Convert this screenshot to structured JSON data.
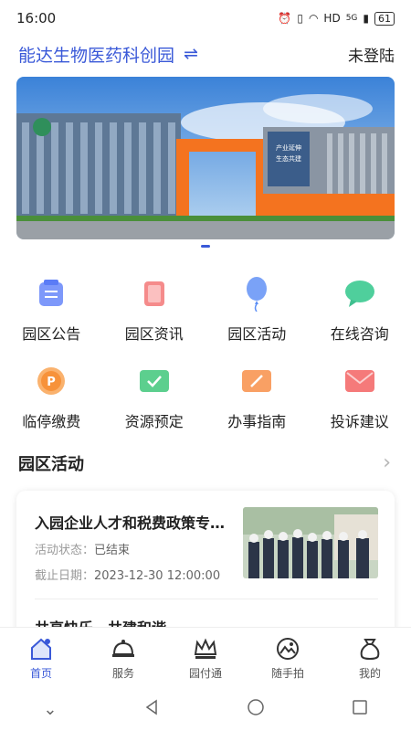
{
  "status": {
    "time": "16:00",
    "network": "HD",
    "signal": "5G",
    "battery": "61"
  },
  "header": {
    "park_name": "能达生物医药科创园",
    "login": "未登陆"
  },
  "banner": {
    "sign_text_1": "产业延伸",
    "sign_text_2": "生态共建"
  },
  "quick_links": [
    {
      "label": "园区公告",
      "icon": "notice-icon",
      "color": "#5b7cf6"
    },
    {
      "label": "园区资讯",
      "icon": "news-icon",
      "color": "#f36b6b"
    },
    {
      "label": "园区活动",
      "icon": "balloon-icon",
      "color": "#5b8ef6"
    },
    {
      "label": "在线咨询",
      "icon": "chat-icon",
      "color": "#3fbf8f"
    },
    {
      "label": "临停缴费",
      "icon": "parking-icon",
      "color": "#f7923a"
    },
    {
      "label": "资源预定",
      "icon": "booking-icon",
      "color": "#3fbf7a"
    },
    {
      "label": "办事指南",
      "icon": "guide-icon",
      "color": "#f7823a"
    },
    {
      "label": "投诉建议",
      "icon": "mail-icon",
      "color": "#f25f5f"
    }
  ],
  "section": {
    "title": "园区活动"
  },
  "activities": [
    {
      "title": "入园企业人才和税费政策专…",
      "status_label": "活动状态：",
      "status": "已结束",
      "deadline_label": "截止日期：",
      "deadline": "2023-12-30 12:00:00"
    },
    {
      "title": "共享快乐，共建和谐"
    }
  ],
  "tabs": [
    {
      "label": "首页",
      "icon": "home-icon",
      "active": true
    },
    {
      "label": "服务",
      "icon": "service-bell-icon",
      "active": false
    },
    {
      "label": "园付通",
      "icon": "crown-icon",
      "active": false
    },
    {
      "label": "随手拍",
      "icon": "camera-icon",
      "active": false
    },
    {
      "label": "我的",
      "icon": "bag-icon",
      "active": false
    }
  ],
  "colors": {
    "accent": "#3a59d8"
  }
}
